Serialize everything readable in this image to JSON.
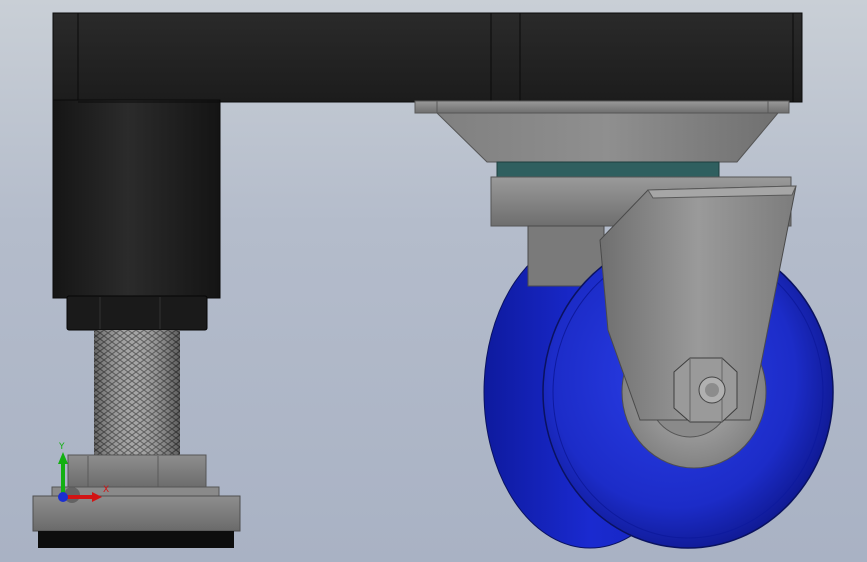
{
  "viewport": {
    "background_top": "#c9cfd6",
    "background_bottom": "#a9b2c4"
  },
  "parts": {
    "frame": {
      "color": "#202020"
    },
    "leveling_foot": {
      "nut_color": "#1a1a1a",
      "thread_color": "#8a8a8a",
      "base_color": "#7c7c7c",
      "pad_color": "#0d0d0d"
    },
    "caster": {
      "mount_plate_color": "#8a8a8a",
      "bearing_ring_color": "#2f5f5f",
      "fork_color": "#8c8c8c",
      "wheel_color": "#1f2fd6",
      "hub_color": "#9c9c9c",
      "axle_nut_color": "#8f8f8f"
    }
  },
  "triad": {
    "x_label": "X",
    "y_label": "Y",
    "x_color": "#d21414",
    "y_color": "#12b012",
    "z_color": "#1b2fd0"
  }
}
